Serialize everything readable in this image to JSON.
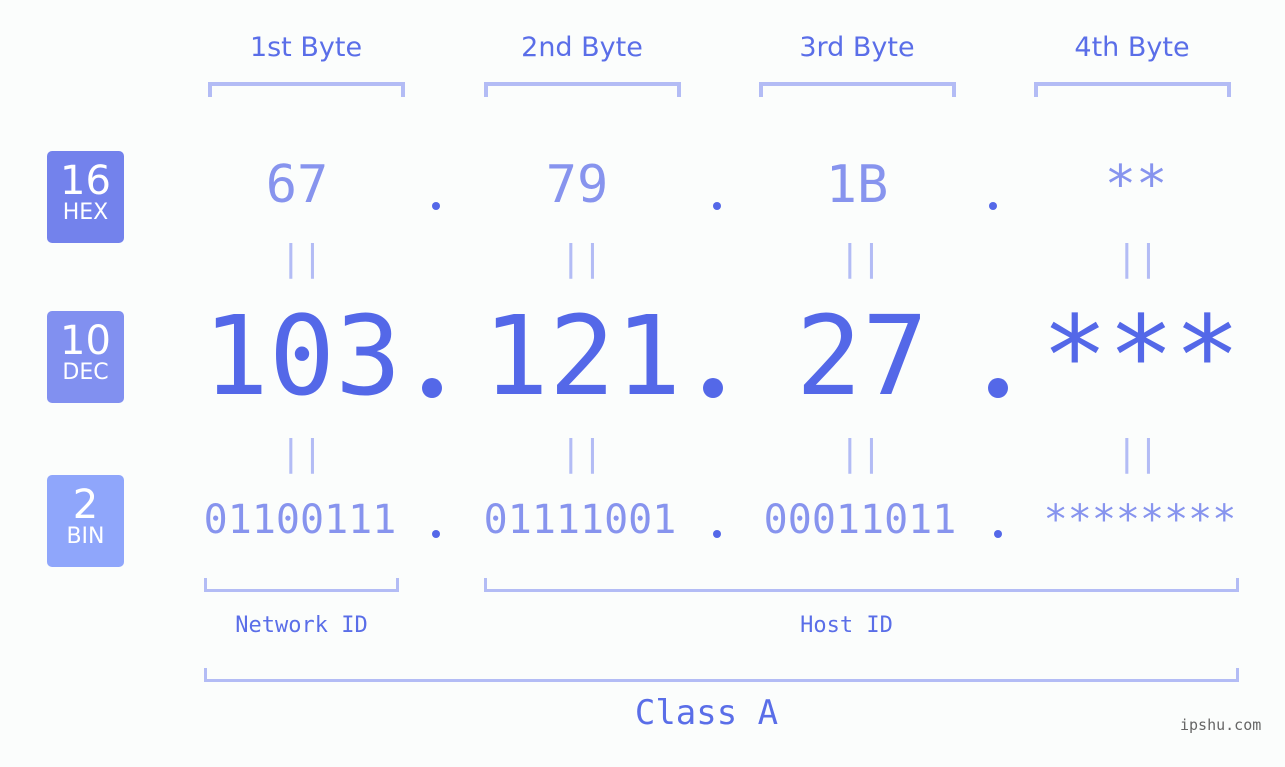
{
  "byte_headers": [
    "1st Byte",
    "2nd Byte",
    "3rd Byte",
    "4th Byte"
  ],
  "badges": {
    "hex": {
      "number": "16",
      "label": "HEX",
      "color": "#7382ec"
    },
    "dec": {
      "number": "10",
      "label": "DEC",
      "color": "#8190f0"
    },
    "bin": {
      "number": "2",
      "label": "BIN",
      "color": "#8fa6fb"
    }
  },
  "hex_values": [
    "67",
    "79",
    "1B",
    "**"
  ],
  "dec_values": [
    "103",
    "121",
    "27",
    "***"
  ],
  "bin_values": [
    "01100111",
    "01111001",
    "00011011",
    "********"
  ],
  "equals_symbol": "||",
  "network_label": "Network ID",
  "host_label": "Host ID",
  "class_label": "Class A",
  "watermark": "ipshu.com",
  "colors": {
    "accent": "#5468e8",
    "light_accent": "#8794ee",
    "bracket": "#b3bcf5",
    "background": "#fbfdfc"
  }
}
